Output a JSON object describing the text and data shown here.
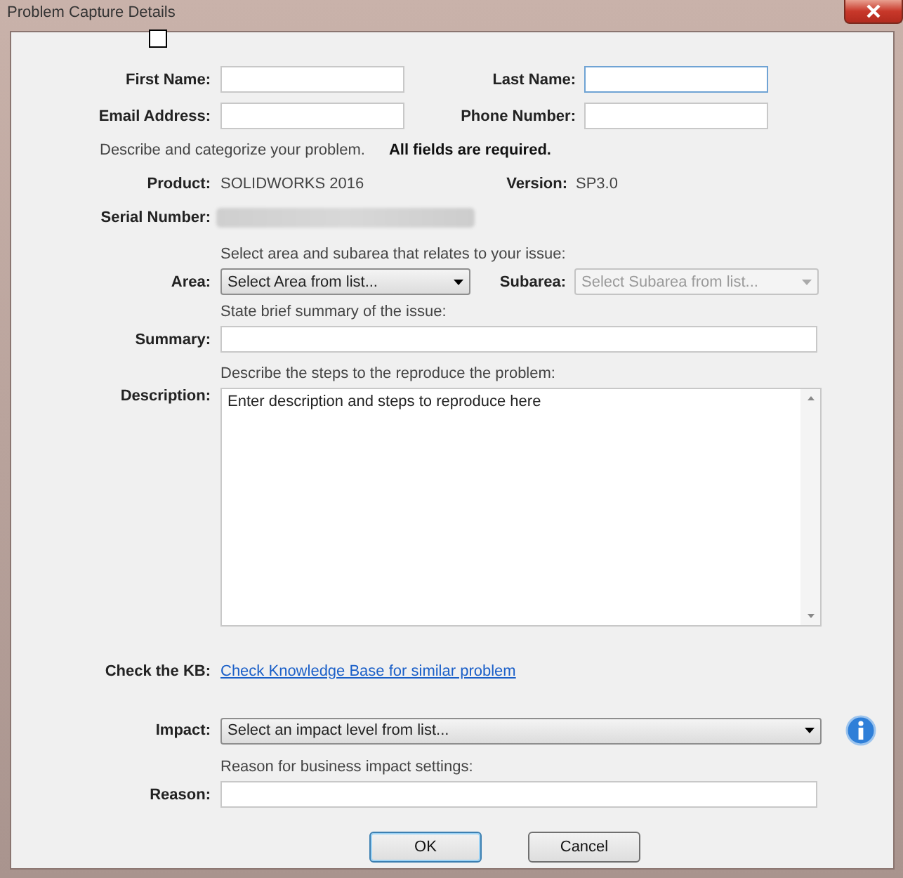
{
  "window": {
    "title": "Problem Capture Details"
  },
  "checkbox": {
    "checked": false
  },
  "contact_fields": [
    {
      "label": "First Name:",
      "focused": false
    },
    {
      "label": "Last Name:",
      "focused": true
    },
    {
      "label": "Email Address:",
      "focused": false
    },
    {
      "label": "Phone Number:",
      "focused": false
    }
  ],
  "instructions": "Describe and categorize your problem.",
  "required_note": "All fields are required.",
  "product": {
    "label": "Product:",
    "value": "SOLIDWORKS 2016"
  },
  "version": {
    "label": "Version:",
    "value": "SP3.0"
  },
  "serial": {
    "label": "Serial Number:"
  },
  "area_hint": "Select area and subarea that relates to your issue:",
  "area": {
    "label": "Area:",
    "value": "Select Area from list...",
    "disabled": false
  },
  "subarea": {
    "label": "Subarea:",
    "value": "Select Subarea from list...",
    "disabled": true
  },
  "summary": {
    "hint": "State brief summary of the issue:",
    "label": "Summary:"
  },
  "description": {
    "hint": "Describe the steps to the reproduce the problem:",
    "label": "Description:",
    "value": "Enter description and steps to reproduce here"
  },
  "kb": {
    "label": "Check the KB:",
    "link": "Check Knowledge Base for similar problem"
  },
  "impact": {
    "label": "Impact:",
    "value": "Select an impact level from list..."
  },
  "reason": {
    "hint": "Reason for business impact settings:",
    "label": "Reason:"
  },
  "buttons": [
    {
      "label": "OK",
      "default": true
    },
    {
      "label": "Cancel",
      "default": false
    }
  ]
}
